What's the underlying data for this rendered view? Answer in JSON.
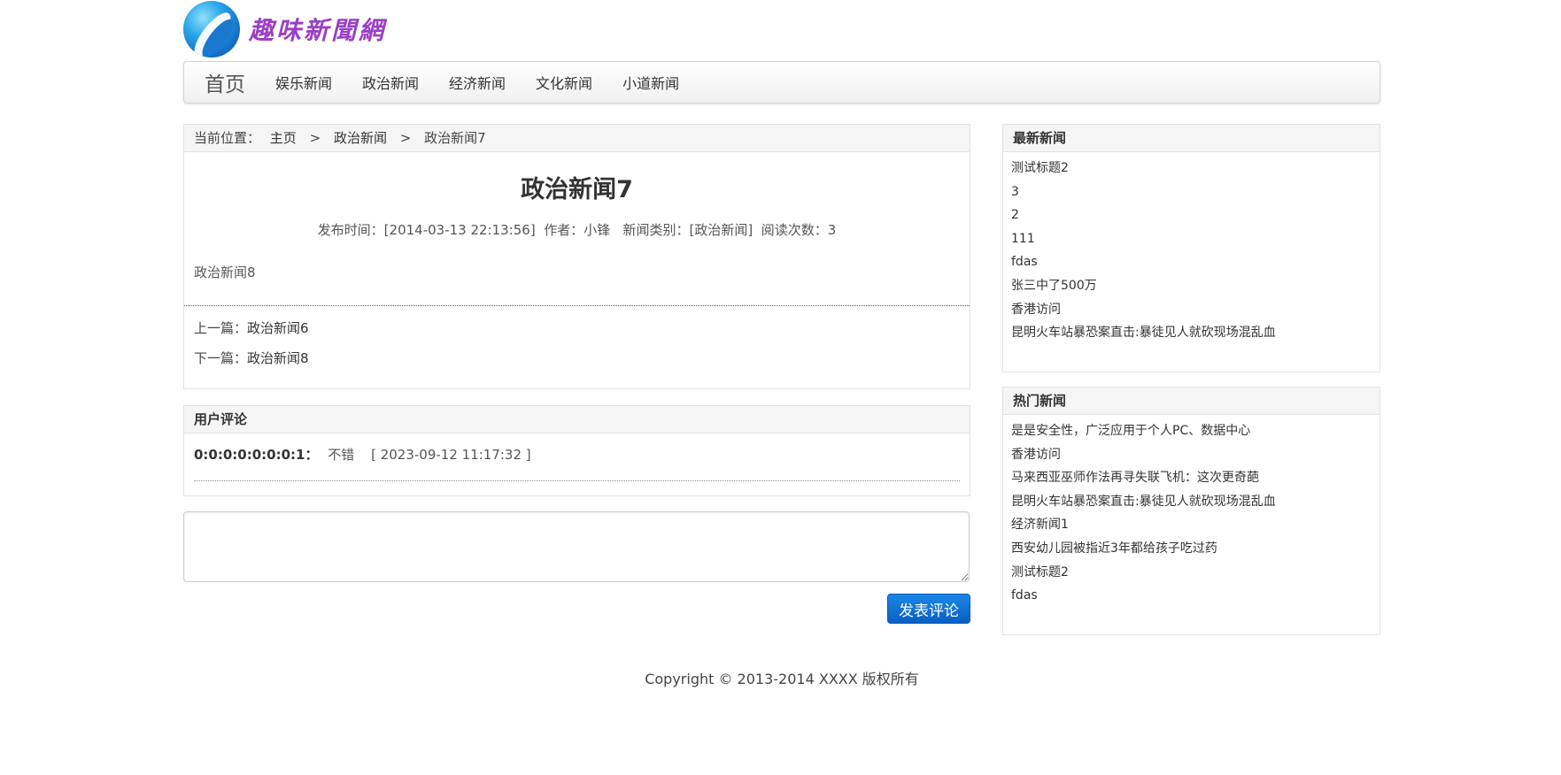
{
  "logo": {
    "text": "趣味新聞網"
  },
  "nav": {
    "brand": "首页",
    "items": [
      {
        "label": "娱乐新闻"
      },
      {
        "label": "政治新闻"
      },
      {
        "label": "经济新闻"
      },
      {
        "label": "文化新闻"
      },
      {
        "label": "小道新闻"
      }
    ]
  },
  "breadcrumb": {
    "prefix": "当前位置：",
    "home": "主页",
    "category": "政治新闻",
    "current": "政治新闻7",
    "separator": ">"
  },
  "article": {
    "title": "政治新闻7",
    "meta": "发布时间：[2014-03-13 22:13:56]  作者：小锋   新闻类别：[政治新闻]  阅读次数：3",
    "body": "政治新闻8",
    "prev_label": "上一篇：",
    "prev_title": "政治新闻6",
    "next_label": "下一篇：",
    "next_title": "政治新闻8"
  },
  "comments": {
    "heading": "用户评论",
    "items": [
      {
        "user": "0:0:0:0:0:0:0:1：",
        "text": "不错",
        "time": "[ 2023-09-12 11:17:32 ]"
      }
    ],
    "textarea_value": "",
    "submit_label": "发表评论"
  },
  "latest": {
    "heading": "最新新闻",
    "items": [
      "测试标题2",
      "3",
      "2",
      "111",
      "fdas",
      "张三中了500万",
      "香港访问",
      "昆明火车站暴恐案直击:暴徒见人就砍现场混乱血"
    ]
  },
  "hot": {
    "heading": "热门新闻",
    "items": [
      "是是安全性，广泛应用于个人PC、数据中心",
      "香港访问",
      "马来西亚巫师作法再寻失联飞机：这次更奇葩",
      "昆明火车站暴恐案直击:暴徒见人就砍现场混乱血",
      "经济新闻1",
      "西安幼儿园被指近3年都给孩子吃过药",
      "测试标题2",
      "fdas"
    ]
  },
  "footer": {
    "text": "Copyright © 2013-2014 XXXX 版权所有"
  },
  "colors": {
    "accent": "#0b5fc2",
    "logo_text": "#9b3fc4"
  }
}
